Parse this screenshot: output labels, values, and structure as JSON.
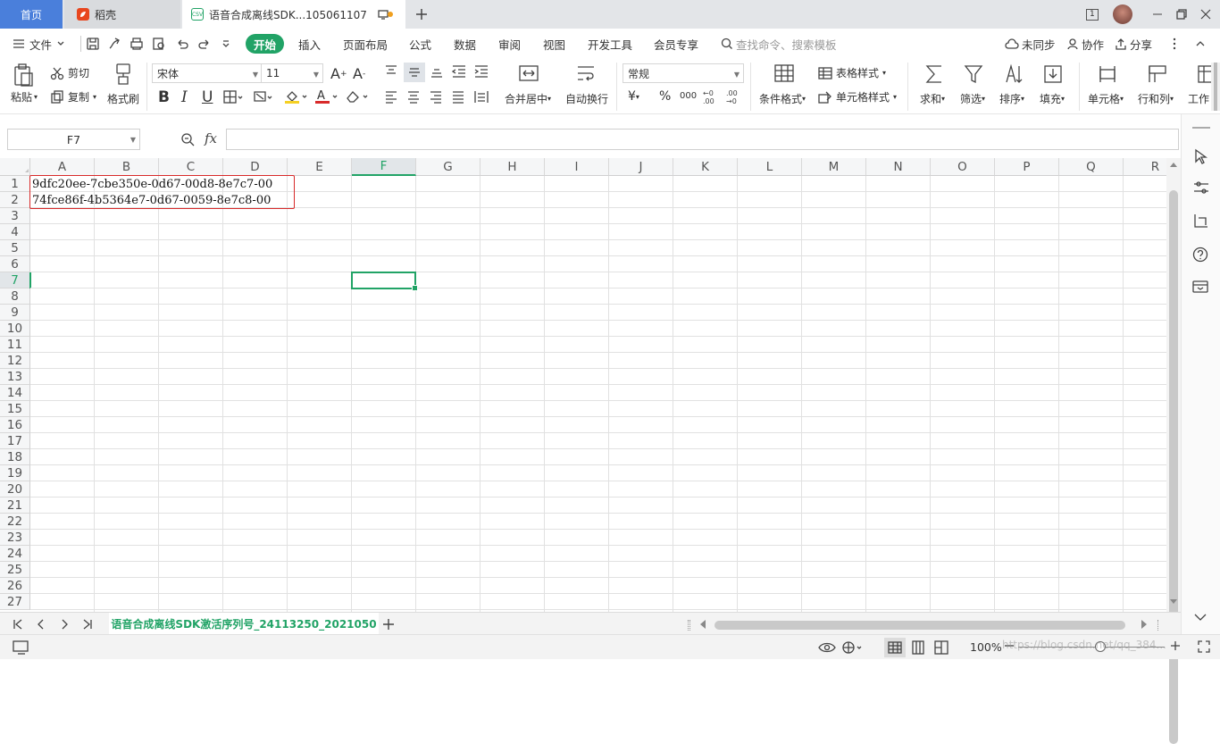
{
  "tabs": {
    "home": "首页",
    "daoke": "稻壳",
    "file": "语音合成离线SDK...105061107",
    "file_badge": "CSV"
  },
  "window": {
    "page_indicator": "1"
  },
  "toolbar": {
    "file_menu": "文件",
    "menus": [
      "开始",
      "插入",
      "页面布局",
      "公式",
      "数据",
      "审阅",
      "视图",
      "开发工具",
      "会员专享"
    ],
    "search_placeholder": "查找命令、搜索模板",
    "sync": "未同步",
    "collab": "协作",
    "share": "分享"
  },
  "ribbon": {
    "paste": "粘贴",
    "cut": "剪切",
    "copy": "复制",
    "format_painter": "格式刷",
    "font_name": "宋体",
    "font_size": "11",
    "merge_center": "合并居中",
    "wrap_text": "自动换行",
    "number_format": "常规",
    "conditional_format": "条件格式",
    "table_style": "表格样式",
    "cell_style": "单元格样式",
    "sum": "求和",
    "filter": "筛选",
    "sort": "排序",
    "fill": "填充",
    "cells": "单元格",
    "rows_cols": "行和列",
    "worksheet": "工作",
    "currency": "¥",
    "percent": "%",
    "thousands": "000"
  },
  "formula": {
    "name_box": "F7",
    "fx": "fx",
    "value": ""
  },
  "columns": [
    "A",
    "B",
    "C",
    "D",
    "E",
    "F",
    "G",
    "H",
    "I",
    "J",
    "K",
    "L",
    "M",
    "N",
    "O",
    "P",
    "Q",
    "R"
  ],
  "rows": [
    "1",
    "2",
    "3",
    "4",
    "5",
    "6",
    "7",
    "8",
    "9",
    "10",
    "11",
    "12",
    "13",
    "14",
    "15",
    "16",
    "17",
    "18",
    "19",
    "20",
    "21",
    "22",
    "23",
    "24",
    "25",
    "26",
    "27"
  ],
  "cells": {
    "A1": "9dfc20ee-7cbe350e-0d67-00d8-8e7c7-00",
    "A2": "74fce86f-4b5364e7-0d67-0059-8e7c8-00"
  },
  "selected": {
    "column": "F",
    "row": "7"
  },
  "sheet": {
    "name": "语音合成离线SDK激活序列号_24113250_2021050"
  },
  "status": {
    "zoom": "100%",
    "watermark": "https://blog.csdn.net/qq_384..."
  },
  "colors": {
    "accent": "#21a366",
    "home_tab": "#4a7fdb",
    "highlight": "#d82a2a"
  }
}
